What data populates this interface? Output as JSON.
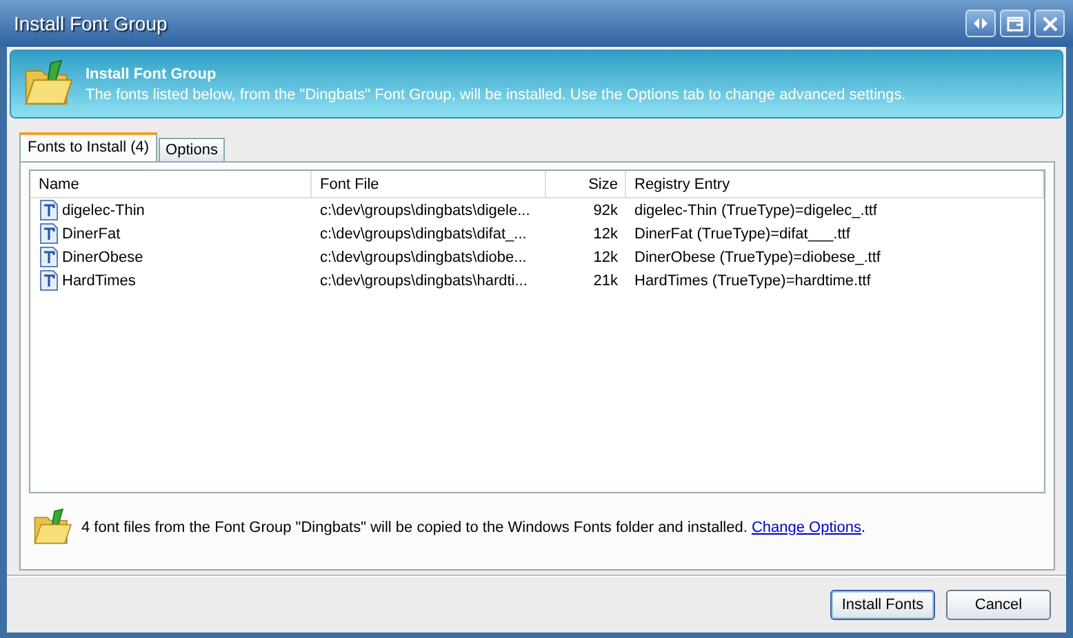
{
  "window": {
    "title": "Install Font Group"
  },
  "header": {
    "title": "Install Font Group",
    "description": "The fonts listed below, from the \"Dingbats\" Font Group, will be installed. Use the Options tab to change advanced settings."
  },
  "tabs": [
    {
      "label": "Fonts to Install (4)",
      "selected": true
    },
    {
      "label": "Options",
      "selected": false
    }
  ],
  "table": {
    "columns": [
      "Name",
      "Font File",
      "Size",
      "Registry Entry"
    ],
    "rows": [
      {
        "name": "digelec-Thin",
        "file": "c:\\dev\\groups\\dingbats\\digele...",
        "size": "92k",
        "registry": "digelec-Thin (TrueType)=digelec_.ttf"
      },
      {
        "name": "DinerFat",
        "file": "c:\\dev\\groups\\dingbats\\difat_...",
        "size": "12k",
        "registry": "DinerFat (TrueType)=difat___.ttf"
      },
      {
        "name": "DinerObese",
        "file": "c:\\dev\\groups\\dingbats\\diobe...",
        "size": "12k",
        "registry": "DinerObese (TrueType)=diobese_.ttf"
      },
      {
        "name": "HardTimes",
        "file": "c:\\dev\\groups\\dingbats\\hardti...",
        "size": "21k",
        "registry": "HardTimes (TrueType)=hardtime.ttf"
      }
    ]
  },
  "note": {
    "text": "4 font files from the Font Group \"Dingbats\" will be copied to the Windows Fonts folder and installed. ",
    "link": "Change Options",
    "end": "."
  },
  "buttons": [
    "Install Fonts",
    "Cancel"
  ]
}
